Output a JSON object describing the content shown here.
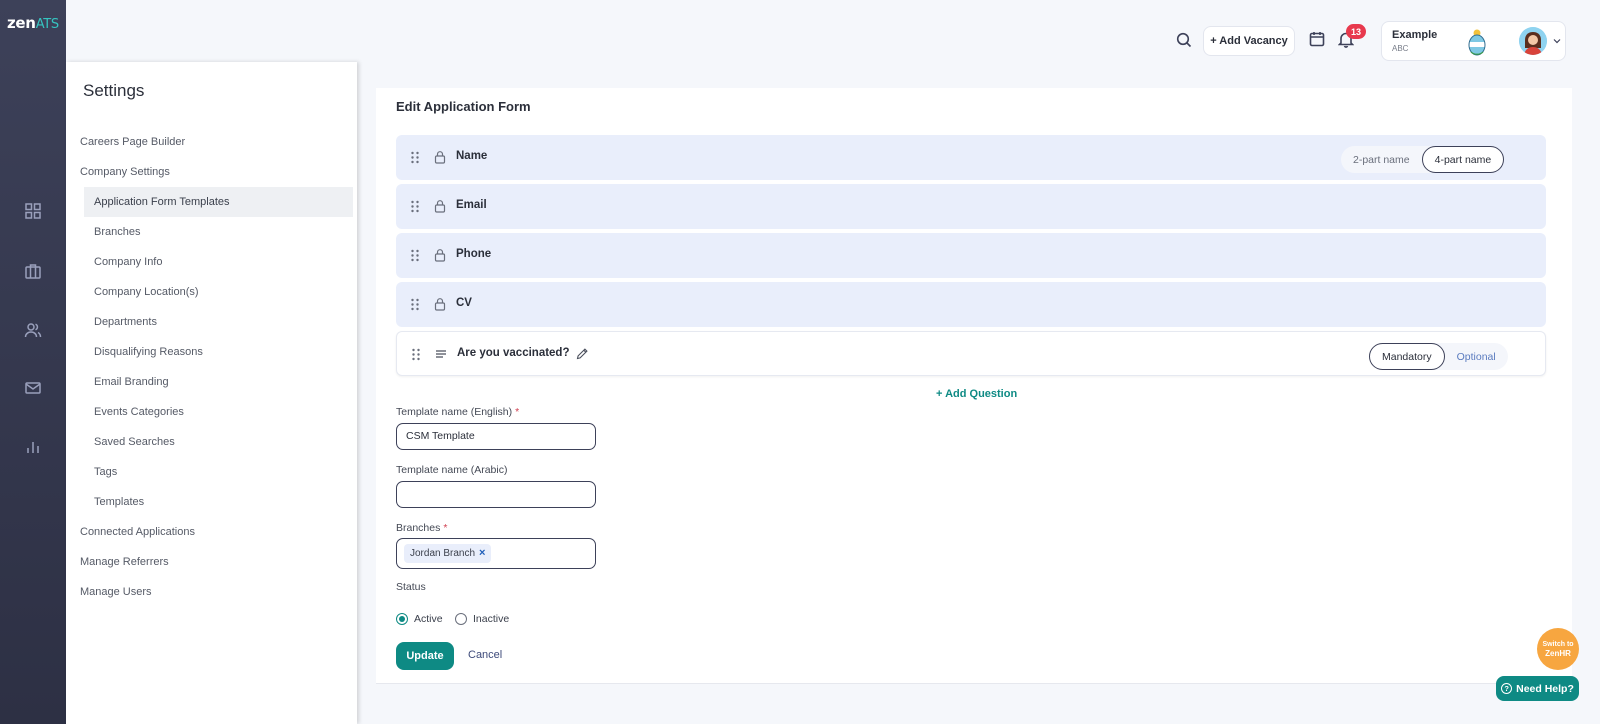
{
  "app": {
    "logo_main": "zen",
    "logo_accent": "ATS"
  },
  "header": {
    "add_vacancy": "+ Add Vacancy",
    "notifications_count": "13",
    "company_name": "Example",
    "company_sub": "ABC"
  },
  "settings": {
    "title": "Settings",
    "nav": [
      {
        "label": "Careers Page Builder"
      },
      {
        "label": "Company Settings"
      },
      {
        "label": "Application Form Templates"
      },
      {
        "label": "Branches"
      },
      {
        "label": "Company Info"
      },
      {
        "label": "Company Location(s)"
      },
      {
        "label": "Departments"
      },
      {
        "label": "Disqualifying Reasons"
      },
      {
        "label": "Email Branding"
      },
      {
        "label": "Events Categories"
      },
      {
        "label": "Saved Searches"
      },
      {
        "label": "Tags"
      },
      {
        "label": "Templates"
      },
      {
        "label": "Connected Applications"
      },
      {
        "label": "Manage Referrers"
      },
      {
        "label": "Manage Users"
      }
    ]
  },
  "form": {
    "title": "Edit Application Form",
    "fields": [
      {
        "label": "Name",
        "opt_a": "2-part name",
        "opt_b": "4-part name"
      },
      {
        "label": "Email"
      },
      {
        "label": "Phone"
      },
      {
        "label": "CV"
      },
      {
        "label": "Are you vaccinated?",
        "opt_a": "Mandatory",
        "opt_b": "Optional"
      }
    ],
    "add_question": "+ Add Question",
    "template_en_label": "Template name (English)",
    "template_en_value": "CSM Template",
    "template_ar_label": "Template name (Arabic)",
    "template_ar_value": "",
    "branches_label": "Branches",
    "branch_chip": "Jordan Branch",
    "chip_remove": "×",
    "required_mark": "*",
    "status_label": "Status",
    "status_active": "Active",
    "status_inactive": "Inactive",
    "update": "Update",
    "cancel": "Cancel"
  },
  "floating": {
    "switch_line1": "Switch to",
    "switch_line2": "ZenHR",
    "help": "Need Help?",
    "help_glyph": "?"
  },
  "colors": {
    "accent": "#0e8a84",
    "rail": "#3d4159",
    "badge": "#e8394d",
    "switch": "#f7a640"
  }
}
